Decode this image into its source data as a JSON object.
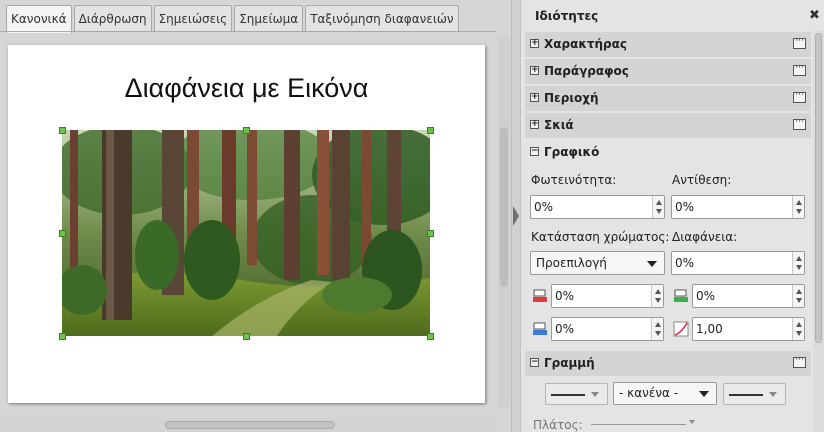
{
  "tabs": [
    {
      "label": "Κανονικά",
      "active": true
    },
    {
      "label": "Διάρθρωση",
      "active": false
    },
    {
      "label": "Σημειώσεις",
      "active": false
    },
    {
      "label": "Σημείωμα",
      "active": false
    },
    {
      "label": "Ταξινόμηση διαφανειών",
      "active": false
    }
  ],
  "slide": {
    "title": "Διαφάνεια με Εικόνα",
    "image": "forest-photo"
  },
  "sidebar": {
    "title": "Ιδιότητες",
    "sections": [
      {
        "label": "Χαρακτήρας",
        "expanded": false
      },
      {
        "label": "Παράγραφος",
        "expanded": false
      },
      {
        "label": "Περιοχή",
        "expanded": false
      },
      {
        "label": "Σκιά",
        "expanded": false
      },
      {
        "label": "Γραφικό",
        "expanded": true
      },
      {
        "label": "Γραμμή",
        "expanded": true
      }
    ],
    "graphic": {
      "brightness_label": "Φωτεινότητα:",
      "brightness_value": "0%",
      "contrast_label": "Αντίθεση:",
      "contrast_value": "0%",
      "color_mode_label": "Κατάσταση χρώματος:",
      "color_mode_value": "Προεπιλογή",
      "transparency_label": "Διαφάνεια:",
      "transparency_value": "0%",
      "red_value": "0%",
      "green_value": "0%",
      "blue_value": "0%",
      "gamma_value": "1,00"
    },
    "line": {
      "arrow_style_value": "- κανένα -",
      "width_label": "Πλάτος:"
    }
  },
  "colors": {
    "selection_handle": "#6cc24a",
    "red_channel": "#e03c3c",
    "green_channel": "#3bb04a",
    "blue_channel": "#3c78d8"
  }
}
